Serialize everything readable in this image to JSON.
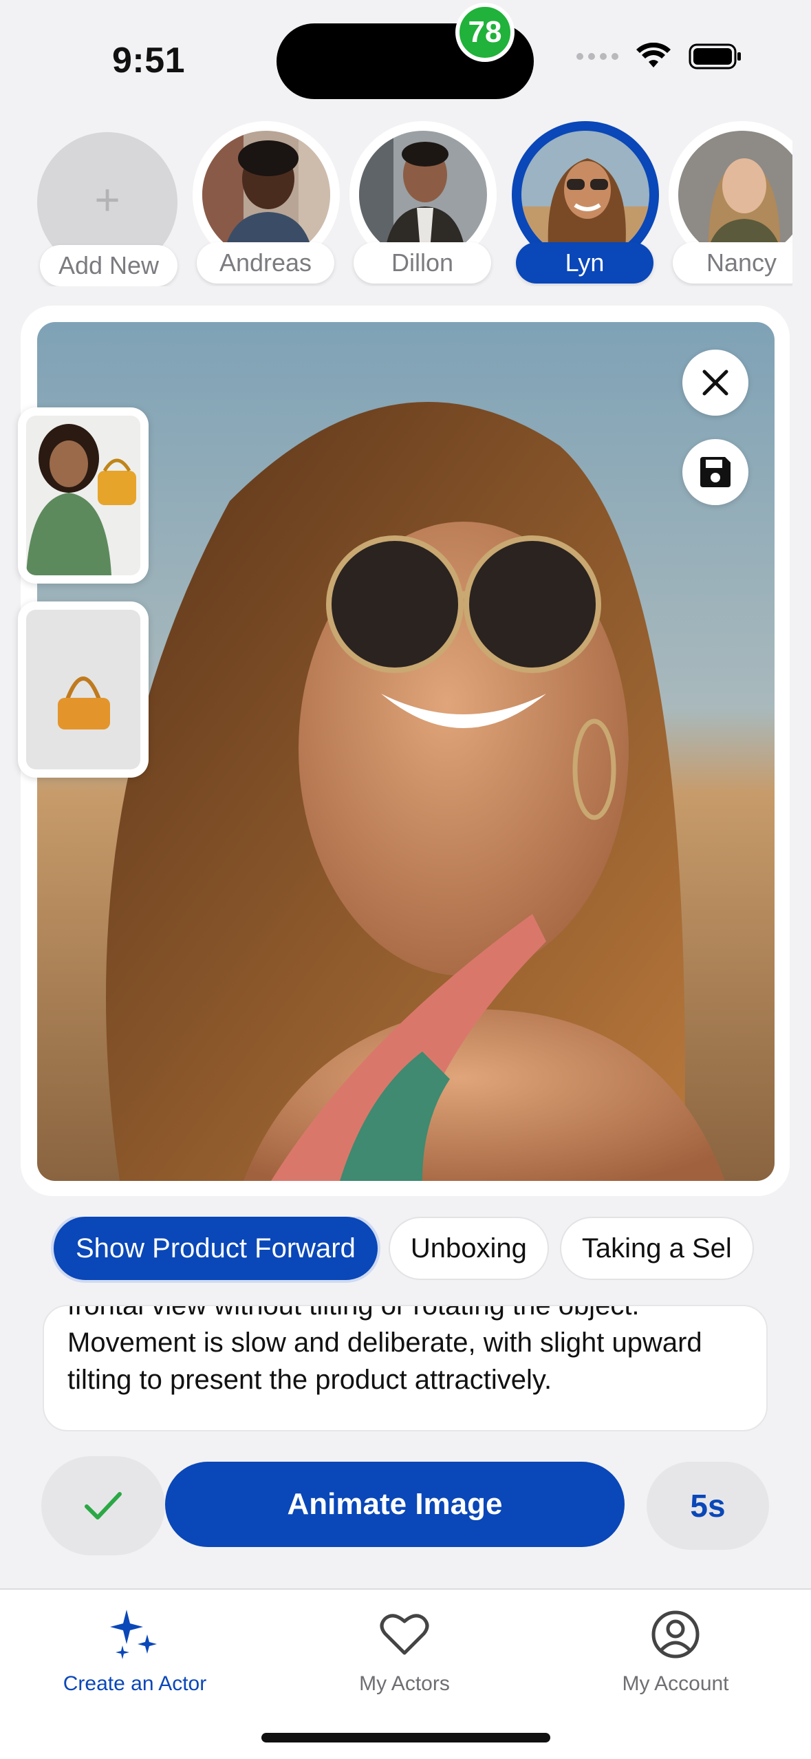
{
  "status_bar": {
    "time": "9:51"
  },
  "actors": {
    "add_label": "Add New",
    "items": [
      {
        "name": "Andreas",
        "selected": false
      },
      {
        "name": "Dillon",
        "selected": false
      },
      {
        "name": "Lyn",
        "selected": true,
        "badge": "78"
      },
      {
        "name": "Nancy",
        "selected": false
      }
    ]
  },
  "editor": {
    "close_icon": "close-icon",
    "save_icon": "floppy-disk-icon"
  },
  "prompts": {
    "chips": [
      "Show Product Forward",
      "Unboxing",
      "Taking a Sel"
    ],
    "active": "Show Product Forward",
    "description": "frontal view without tilting or rotating the object. Movement is slow and deliberate, with slight upward tilting to present the product attractively."
  },
  "actions": {
    "confirm_icon": "checkmark-icon",
    "animate_label": "Animate Image",
    "duration_label": "5s"
  },
  "tabbar": {
    "tabs": [
      {
        "label": "Create an Actor",
        "icon": "sparkles-icon",
        "active": true
      },
      {
        "label": "My Actors",
        "icon": "heart-icon",
        "active": false
      },
      {
        "label": "My Account",
        "icon": "person-circle-icon",
        "active": false
      }
    ]
  },
  "colors": {
    "accent": "#0a47b8",
    "badge": "#20b23a",
    "check": "#2aa845"
  }
}
